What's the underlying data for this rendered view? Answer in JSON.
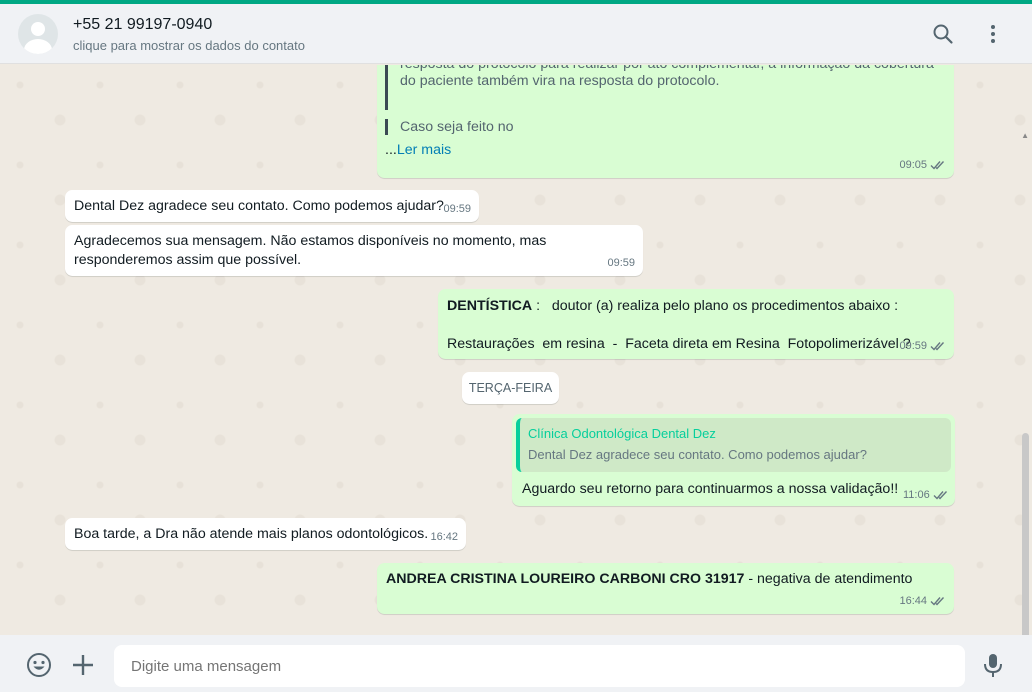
{
  "header": {
    "contact_name": "+55 21 99197-0940",
    "contact_subtitle": "clique para mostrar os dados do contato",
    "icons": [
      "search-icon",
      "menu-icon"
    ]
  },
  "messages": {
    "m1": {
      "quote_line1": "resposta do protocolo para realizar por ato complementar, a informação da cobertura",
      "quote_line2": "do paciente também vira na resposta do protocolo.",
      "quote2": "Caso seja feito no",
      "read_more_prefix": "...",
      "read_more": "Ler mais",
      "time": "09:05"
    },
    "m2": {
      "text": "Dental Dez agradece seu contato. Como podemos ajudar?",
      "time": "09:59"
    },
    "m3": {
      "line1": "Agradecemos sua mensagem. Não estamos disponíveis no momento, mas",
      "line2": "responderemos assim que possível.",
      "time": "09:59"
    },
    "m4": {
      "bold": "DENTÍSTICA",
      "rest": " :   doutor (a) realiza pelo plano os procedimentos abaixo :",
      "line2": "Restaurações  em resina  -  Faceta direta em Resina  Fotopolimerizável ?",
      "time": "09:59"
    },
    "date_divider": "TERÇA-FEIRA",
    "m5": {
      "reply_author": "Clínica Odontológica Dental Dez",
      "reply_text": "Dental Dez agradece seu contato. Como podemos ajudar?",
      "text": "Aguardo seu retorno para continuarmos a nossa validação!!",
      "time": "11:06"
    },
    "m6": {
      "text": "Boa tarde, a Dra não atende mais planos odontológicos.",
      "time": "16:42"
    },
    "m7": {
      "bold": "ANDREA CRISTINA LOUREIRO CARBONI CRO 31917",
      "rest": " - negativa de atendimento",
      "time": "16:44"
    }
  },
  "footer": {
    "placeholder": "Digite uma mensagem",
    "icons": [
      "emoji-icon",
      "attach-plus-icon",
      "microphone-icon"
    ]
  },
  "colors": {
    "accent": "#00a884",
    "outgoing": "#d9fdd3",
    "incoming": "#ffffff",
    "chat_bg": "#efeae2",
    "read_ticks": "#667781"
  }
}
